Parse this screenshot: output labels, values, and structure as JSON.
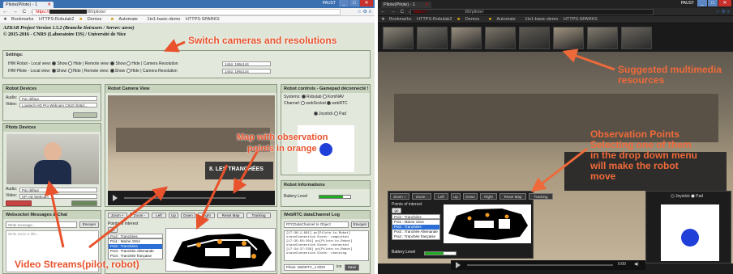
{
  "left": {
    "browser": {
      "tab_title": "Pilote(Pilote) - 1",
      "tab_close": "✕",
      "nav_icons": "← → C ⌂",
      "url_protocol": "https://",
      "url_path": ":80/pilote/",
      "profile_label": "PAUST",
      "toolbar_icons": "☆ ⚙ ≡",
      "bookmarks_label": "Bookmarks",
      "bookmarks": [
        "HTTPS-Robulab2",
        "Demos",
        "Automate",
        "1to1-basic-demo",
        "HTTPS-SPARKS"
      ]
    },
    "header": {
      "title": "AZKAR Project Version 1.5.2 (Branche Iiot/users / Server: azvee)",
      "subtitle": "© 2015-2016 - CNRS (Laboratoire I3S) / Université de Nice"
    },
    "settings": {
      "title": "Settings:",
      "row1": "IHM Robot - Local view:",
      "row2": "IHM Pilote - Local view:",
      "show": "Show",
      "hide": "Hide",
      "remote": "Remote view:",
      "resolution": "Camera Resolution",
      "res_value": "144p: 196x144"
    },
    "robot_devices": {
      "title": "Robot Devices",
      "audio_label": "Audio:",
      "audio_value": "Par défaut",
      "video_label": "Video:",
      "video_value": "Logitech HD Pro Webcam C910 (046d:..."
    },
    "pilot_devices": {
      "title": "Pilots Devices",
      "audio_label": "Audio:",
      "audio_value": "Par défaut",
      "video_label": "Video:",
      "video_value": "HP HD Webcam"
    },
    "camera": {
      "title": "Robot Camera View",
      "scene_text": "8. LES TRANCHÉES"
    },
    "controls": {
      "title": "Robot controls - Gamepad déconnecté !",
      "systems": "Systems:",
      "robulab": "Robulab",
      "komnav": "KomNAV",
      "channel": "Channel:",
      "websocket": "webSocket",
      "webrtc": "webRTC",
      "joystick": "Joystick",
      "pad": "Pad"
    },
    "battery": {
      "title": "Robot Informations",
      "label": "Battery Level",
      "level": 0.75
    },
    "chat": {
      "title": "Websocket Messages & Chat",
      "placeholder": "Write message...",
      "send": "Envoyer",
      "history": "Write some a title..."
    },
    "nav": {
      "buttons": [
        "Zoom +",
        "Zoom -",
        "Left",
        "Up",
        "Down",
        "Right",
        "Reset Map",
        "Tracking"
      ],
      "poi_label": "Points of interest",
      "go": "go",
      "poi_selected": "Poi2 : Tranchées",
      "poi_list": [
        "Poi1 : Marne 1914",
        "Poi2 : Tranchées",
        "Poi3 : Tranchée Allemande",
        "Poi4 : Tranchée française"
      ]
    },
    "webrtc_log": {
      "title": "WebRTC dataChannel Log",
      "input_value": "RTCDataChannel to Object",
      "send": "Envoyer",
      "lines": [
        "[17:36:1-091] pc[Pilote-to-Robot]",
        "stateConnection Event: completed",
        "[17:35:56:264] pc[Pilote-to-Robot]",
        "stateConnection Event: connected",
        "[17:34:37:236] pc[Pilote-to-Robot]",
        "stateConnection Event: checking"
      ],
      "footer_input": "Pilote: WebRTC_1.0/D8",
      "ice": "ice",
      "save": "Save"
    },
    "annotations": {
      "top": "Switch cameras and resolutions",
      "map_line1": "Map with observation",
      "map_line2": "points in orange",
      "bottom": "Video Streams(pilot, robot)"
    }
  },
  "right": {
    "browser": {
      "tab_title": "Pilote(Pilote) - 1",
      "tab_close": "✕",
      "nav_icons": "← → C ⌂",
      "url_protocol": "https://",
      "url_path": ":80/pilote/",
      "profile_label": "PAUST",
      "toolbar_icons": "☆ ⚙ ≡",
      "bookmarks_label": "Bookmarks",
      "bookmarks": [
        "HTTPS-Robulab2",
        "Demos",
        "Automate",
        "1to1-basic-demo",
        "HTTPS-SPARKS"
      ]
    },
    "nav": {
      "buttons": [
        "Zoom +",
        "Zoom -",
        "Left",
        "Up",
        "Down",
        "Right",
        "Reset Map",
        "Tracking"
      ],
      "poi_label": "Points of interest",
      "go": "go",
      "poi_selected": "Poi2 : Tranchées",
      "poi_list": [
        "Poi1 : Marne 1914",
        "Poi2 : Tranchées",
        "Poi3 : Tranchée Allemande",
        "Poi4 : Tranchée française"
      ]
    },
    "battery_label": "Battery Level",
    "battery_level": 0.6,
    "joystick": "Joystick",
    "pad": "Pad",
    "time": "0:00",
    "annotations": {
      "top_line1": "Suggested multimedia",
      "top_line2": "resources",
      "mid_line1": "Observation Points",
      "mid_line2": "Selecting one of them",
      "mid_line3": "in the drop down menu",
      "mid_line4": "will make the robot",
      "mid_line5": "move"
    }
  },
  "colors": {
    "annotation": "#e8522c",
    "panel": "#e3e8dd",
    "panel_title": "#c9d4bf",
    "highlight": "#2b6fd6",
    "joystick": "#1f3fd8",
    "battery": "#22aa22"
  }
}
